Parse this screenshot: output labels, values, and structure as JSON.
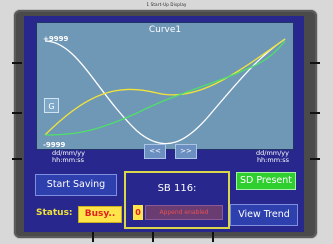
{
  "caption": "1 Start-Up Display",
  "chart": {
    "title": "Curve1",
    "y_top_label": "+9999",
    "y_bottom_label": "-9999",
    "x_left_label_line1": "dd/mm/yy",
    "x_left_label_line2": "hh:mm:ss",
    "x_right_label_line1": "dd/mm/yy",
    "x_right_label_line2": "hh:mm:ss",
    "g_button": "G",
    "prev_button": "<<",
    "next_button": ">>",
    "colors": {
      "background": "#6f97b6",
      "white_curve": "#ffffff",
      "yellow_curve": "#f2e33a",
      "green_curve": "#4ee06a"
    }
  },
  "buttons": {
    "start_saving": "Start Saving",
    "view_trend": "View Trend"
  },
  "status": {
    "label": "Status:",
    "value": "Busy.."
  },
  "sb": {
    "title": "SB 116:",
    "count": "0",
    "append": "Append enabled"
  },
  "sd": {
    "label": "SD Present"
  }
}
